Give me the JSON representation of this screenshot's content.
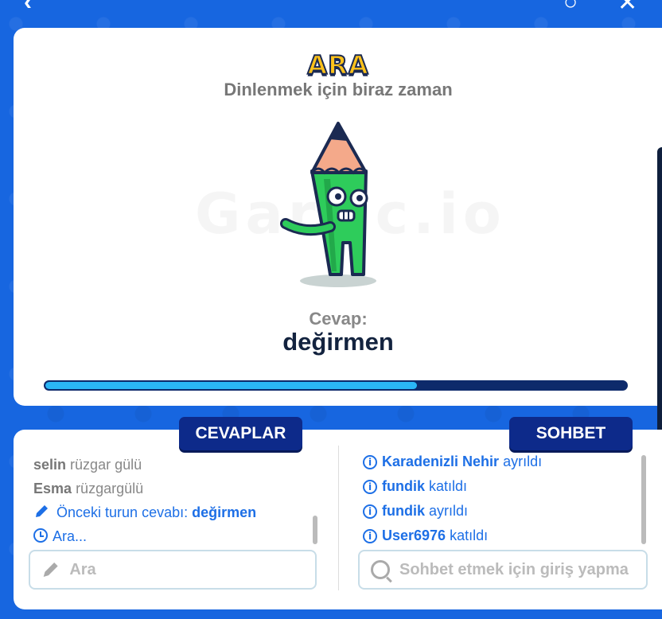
{
  "header": {
    "badge": "ARA",
    "subtitle": "Dinlenmek için biraz zaman"
  },
  "watermark": "Gartic.io",
  "result": {
    "label": "Cevap:",
    "answer": "değirmen"
  },
  "progress": {
    "fraction": 0.64
  },
  "answers_panel": {
    "title": "CEVAPLAR",
    "rows": [
      {
        "user": "selin",
        "text": "rüzgar gülü"
      },
      {
        "user": "Esma",
        "text": "rüzgargülü"
      }
    ],
    "prev_answer_label": "Önceki turun cevabı:",
    "prev_answer": "değirmen",
    "status": "Ara...",
    "input_placeholder": "Ara"
  },
  "chat_panel": {
    "title": "SOHBET",
    "rows": [
      {
        "name": "Karadenizli Nehir",
        "action": "ayrıldı"
      },
      {
        "name": "fundik",
        "action": "katıldı"
      },
      {
        "name": "fundik",
        "action": "ayrıldı"
      },
      {
        "name": "User6976",
        "action": "katıldı"
      }
    ],
    "input_placeholder": "Sohbet etmek için giriş yapma"
  },
  "icons": {
    "pencil": "pencil-icon",
    "clock": "clock-icon",
    "info": "info-icon",
    "search": "search-icon"
  },
  "colors": {
    "background": "#1766e0",
    "accent_blue": "#1d6fe6",
    "tab_navy": "#0d2a8a",
    "badge_yellow": "#ffc21a",
    "progress_fill": "#2ab6f6"
  }
}
